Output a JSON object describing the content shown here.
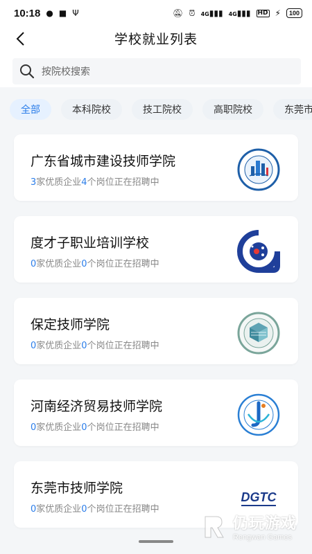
{
  "status_bar": {
    "time": "10:18",
    "signal_1": "4G",
    "signal_2": "4G",
    "hd": "HD",
    "battery": "100"
  },
  "header": {
    "title": "学校就业列表"
  },
  "search": {
    "placeholder": "按院校搜索"
  },
  "tabs": [
    {
      "label": "全部",
      "active": true
    },
    {
      "label": "本科院校"
    },
    {
      "label": "技工院校"
    },
    {
      "label": "高职院校"
    },
    {
      "label": "东莞市"
    }
  ],
  "schools": [
    {
      "name": "广东省城市建设技师学院",
      "companies": "3",
      "text_a": "家优质企业",
      "positions": "4",
      "text_b": "个岗位正在招聘中"
    },
    {
      "name": "度才子职业培训学校",
      "companies": "0",
      "text_a": "家优质企业",
      "positions": "0",
      "text_b": "个岗位正在招聘中"
    },
    {
      "name": "保定技师学院",
      "companies": "0",
      "text_a": "家优质企业",
      "positions": "0",
      "text_b": "个岗位正在招聘中"
    },
    {
      "name": "河南经济贸易技师学院",
      "companies": "0",
      "text_a": "家优质企业",
      "positions": "0",
      "text_b": "个岗位正在招聘中"
    },
    {
      "name": "东莞市技师学院",
      "companies": "0",
      "text_a": "家优质企业",
      "positions": "0",
      "text_b": "个岗位正在招聘中"
    }
  ],
  "logos": {
    "dgtc": "DGTC"
  },
  "watermark": {
    "main": "仍玩游戏",
    "sub": "Rengwan Games"
  },
  "colors": {
    "accent": "#2b7de9",
    "text_secondary": "#888888",
    "background": "#f4f6f8"
  }
}
